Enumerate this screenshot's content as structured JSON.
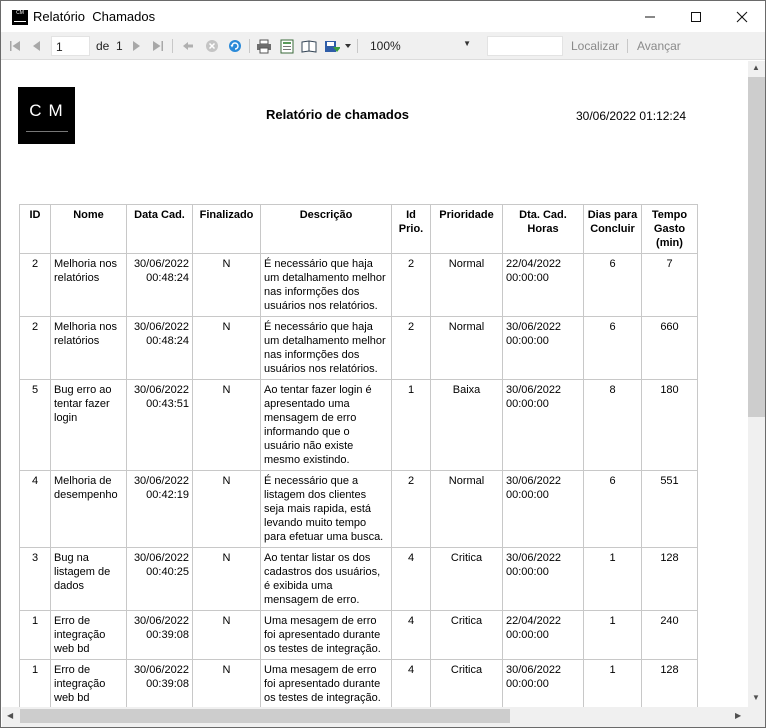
{
  "window": {
    "title": "Relatório  Chamados",
    "icon_text": "CM"
  },
  "toolbar": {
    "page_current": "1",
    "page_of": "de",
    "page_total": "1",
    "zoom": "100%",
    "find_label": "Localizar",
    "next_label": "Avançar"
  },
  "report": {
    "logo_text": "CM",
    "title": "Relatório de chamados",
    "datetime": "30/06/2022 01:12:24"
  },
  "table": {
    "headers": [
      "ID",
      "Nome",
      "Data Cad.",
      "Finalizado",
      "Descrição",
      "Id Prio.",
      "Prioridade",
      "Dta. Cad. Horas",
      "Dias para Concluir",
      "Tempo Gasto (min)"
    ],
    "rows": [
      {
        "id": "2",
        "nome": "Melhoria nos relatórios",
        "data": "30/06/2022 00:48:24",
        "fin": "N",
        "desc": "É necessário que haja um detalhamento melhor nas informções dos usuários nos relatórios.",
        "prio_id": "2",
        "prio": "Normal",
        "dta": "22/04/2022 00:00:00",
        "dias": "6",
        "tempo": "7"
      },
      {
        "id": "2",
        "nome": "Melhoria nos relatórios",
        "data": "30/06/2022 00:48:24",
        "fin": "N",
        "desc": "É necessário que haja um detalhamento melhor nas informções dos usuários nos relatórios.",
        "prio_id": "2",
        "prio": "Normal",
        "dta": "30/06/2022 00:00:00",
        "dias": "6",
        "tempo": "660"
      },
      {
        "id": "5",
        "nome": "Bug erro ao tentar fazer login",
        "data": "30/06/2022 00:43:51",
        "fin": "N",
        "desc": "Ao tentar fazer login é apresentado uma mensagem de erro informando que o usuário não existe mesmo existindo.",
        "prio_id": "1",
        "prio": "Baixa",
        "dta": "30/06/2022 00:00:00",
        "dias": "8",
        "tempo": "180"
      },
      {
        "id": "4",
        "nome": "Melhoria de desempenho",
        "data": "30/06/2022 00:42:19",
        "fin": "N",
        "desc": "É necessário que a listagem dos clientes seja mais rapida, está levando muito tempo para efetuar uma busca.",
        "prio_id": "2",
        "prio": "Normal",
        "dta": "30/06/2022 00:00:00",
        "dias": "6",
        "tempo": "551"
      },
      {
        "id": "3",
        "nome": "Bug na listagem de dados",
        "data": "30/06/2022 00:40:25",
        "fin": "N",
        "desc": "Ao tentar listar os dos cadastros dos usuários, é exibida uma mensagem de erro.",
        "prio_id": "4",
        "prio": "Critica",
        "dta": "30/06/2022 00:00:00",
        "dias": "1",
        "tempo": "128"
      },
      {
        "id": "1",
        "nome": "Erro de integração web bd",
        "data": "30/06/2022 00:39:08",
        "fin": "N",
        "desc": "Uma mesagem de erro foi apresentado durante os testes de integração.",
        "prio_id": "4",
        "prio": "Critica",
        "dta": "22/04/2022 00:00:00",
        "dias": "1",
        "tempo": "240"
      },
      {
        "id": "1",
        "nome": "Erro de integração web bd",
        "data": "30/06/2022 00:39:08",
        "fin": "N",
        "desc": "Uma mesagem de erro foi apresentado durante os testes de integração.",
        "prio_id": "4",
        "prio": "Critica",
        "dta": "30/06/2022 00:00:00",
        "dias": "1",
        "tempo": "128"
      }
    ]
  }
}
